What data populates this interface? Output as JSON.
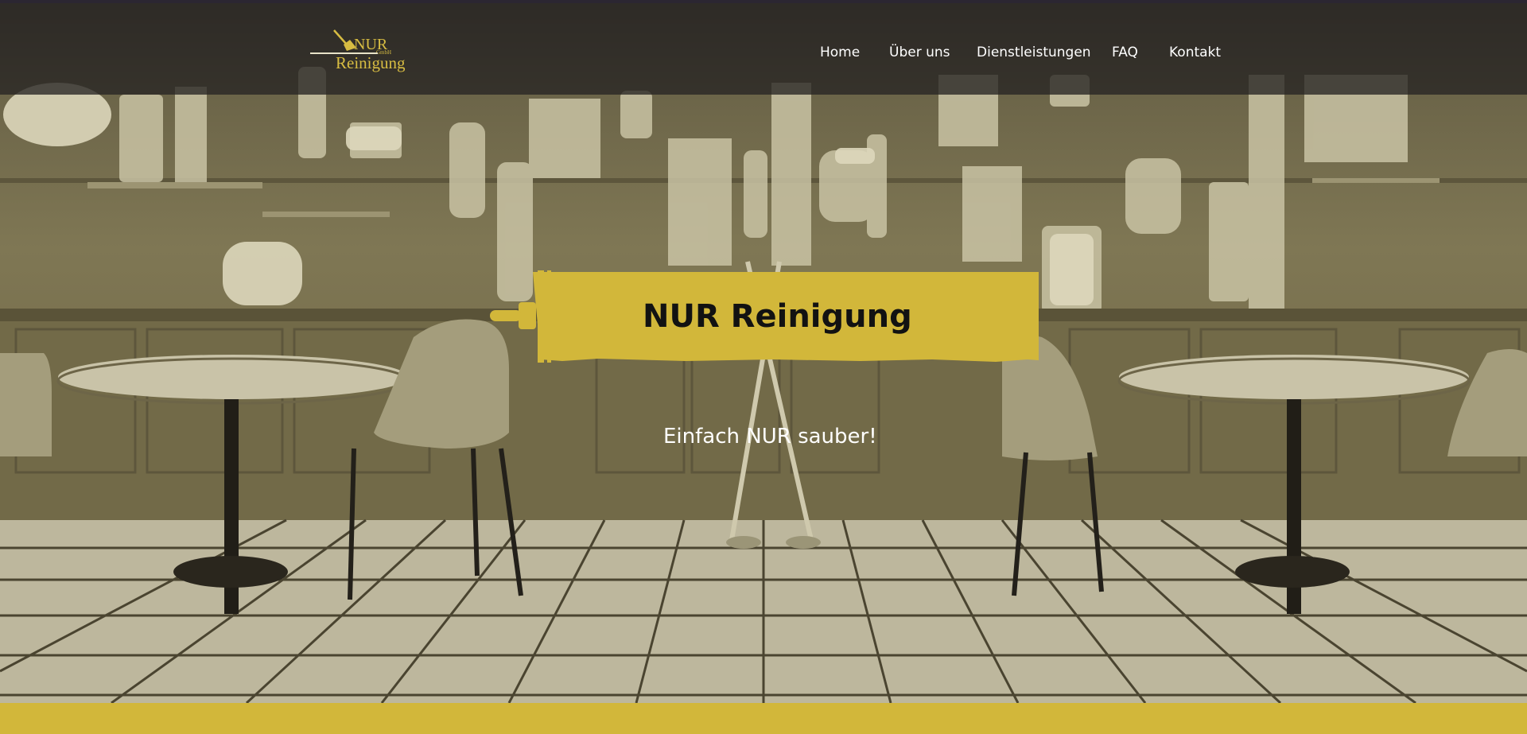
{
  "brand": {
    "logo_word": "NUR",
    "logo_suffix": "GmbH",
    "logo_name": "Reinigung"
  },
  "nav": {
    "items": [
      "Home",
      "Über uns",
      "Dienstleistungen",
      "FAQ",
      "Kontakt"
    ]
  },
  "hero": {
    "title": "NUR Reinigung",
    "tagline": "Einfach NUR sauber!"
  },
  "colors": {
    "accent_yellow": "#d2b73a",
    "header_bg": "#262422",
    "text_light": "#ffffff",
    "title_text": "#121212"
  },
  "icons": {
    "logo_mark": "broom-icon",
    "banner_mark": "paint-brush-icon"
  }
}
